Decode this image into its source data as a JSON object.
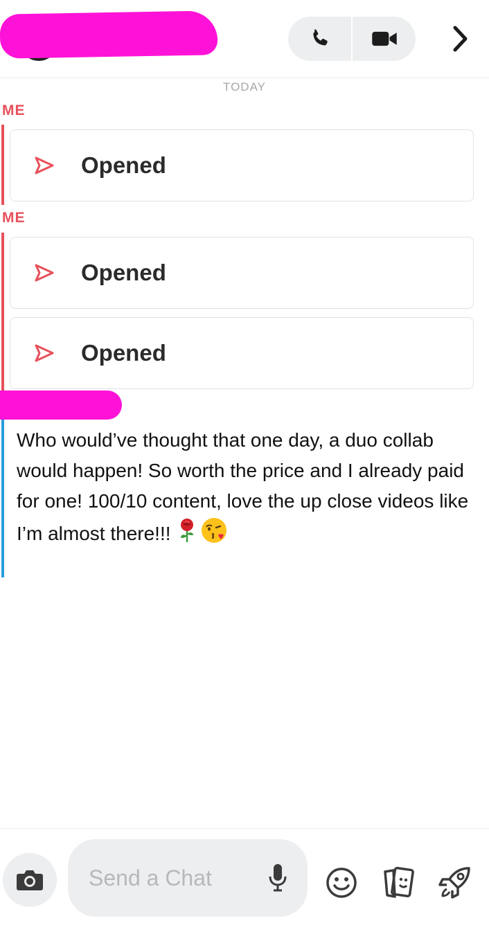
{
  "header": {
    "call_icon": "phone-icon",
    "video_icon": "video-camera-icon",
    "next_icon": "chevron-right-icon"
  },
  "conversation": {
    "day_label": "TODAY",
    "groups": [
      {
        "sender": "ME",
        "items": [
          {
            "status": "Opened",
            "icon": "send-arrow-icon"
          }
        ]
      },
      {
        "sender": "ME",
        "items": [
          {
            "status": "Opened",
            "icon": "send-arrow-icon"
          },
          {
            "status": "Opened",
            "icon": "send-arrow-icon"
          }
        ]
      }
    ],
    "incoming_message": {
      "text": "Who would’ve thought that one day, a duo collab would happen! So worth the price and I already paid for one! 100/10 content, love the up close videos like I’m almost there!!!",
      "emojis": [
        "rose",
        "face-blowing-a-kiss"
      ]
    }
  },
  "composer": {
    "placeholder": "Send a Chat",
    "icons": [
      "camera-icon",
      "microphone-icon",
      "smiley-icon",
      "sticker-cards-icon",
      "rocket-icon"
    ]
  },
  "colors": {
    "sent_accent": "#e8505b",
    "received_accent": "#2a9bde",
    "redaction": "#ff12d7",
    "pill_bg": "#eceef0"
  }
}
